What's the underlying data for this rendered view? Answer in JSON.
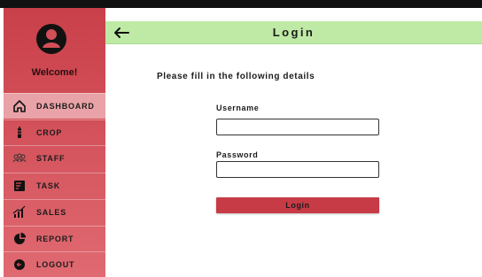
{
  "sidebar": {
    "welcome": "Welcome!",
    "items": [
      {
        "label": "DASHBOARD",
        "icon": "home-icon",
        "active": true
      },
      {
        "label": "CROP",
        "icon": "crop-icon",
        "active": false
      },
      {
        "label": "STAFF",
        "icon": "staff-icon",
        "active": false
      },
      {
        "label": "TASK",
        "icon": "task-icon",
        "active": false
      },
      {
        "label": "SALES",
        "icon": "sales-icon",
        "active": false
      },
      {
        "label": "REPORT",
        "icon": "report-icon",
        "active": false
      },
      {
        "label": "LOGOUT",
        "icon": "logout-icon",
        "active": false
      }
    ]
  },
  "header": {
    "title": "Login",
    "back_icon": "arrow-left-icon"
  },
  "form": {
    "instructions": "Please fill in the following details",
    "username_label": "Username",
    "username_value": "",
    "password_label": "Password",
    "password_value": "",
    "submit_label": "Login"
  },
  "colors": {
    "sidebar": "#d24f58",
    "sidebar_active": "#e9a2a7",
    "header": "#bfeaa5",
    "button": "#c73b47"
  }
}
